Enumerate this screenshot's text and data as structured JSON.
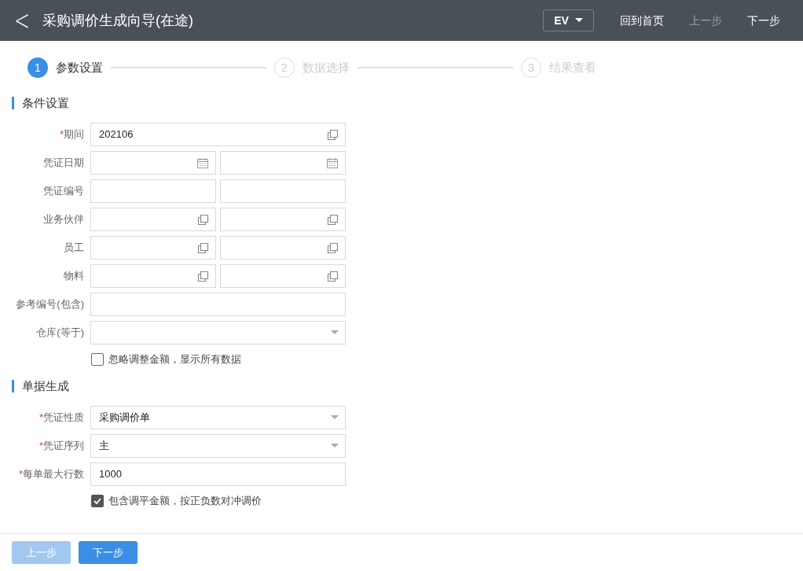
{
  "header": {
    "back": "<",
    "title": "采购调价生成向导(在途)",
    "language": "EV",
    "actions": [
      {
        "label": "回到首页",
        "disabled": false
      },
      {
        "label": "上一步",
        "disabled": true
      },
      {
        "label": "下一步",
        "disabled": false
      }
    ]
  },
  "steps": [
    {
      "number": "1",
      "label": "参数设置",
      "selected": true
    },
    {
      "number": "2",
      "label": "数据选择",
      "selected": false
    },
    {
      "number": "3",
      "label": "结果查看",
      "selected": false
    }
  ],
  "sections": [
    {
      "title": "条件设置",
      "rows": [
        {
          "asterisk": "*",
          "label": "期间",
          "fields": [
            {
              "value": "202106",
              "kind": "lookup"
            }
          ]
        },
        {
          "label": "凭证日期",
          "fields": [
            {
              "kind": "calendar"
            },
            {
              "kind": "calendar"
            }
          ]
        },
        {
          "label": "凭证编号",
          "fields": [
            {
              "kind": "text"
            },
            {
              "kind": "text"
            }
          ]
        },
        {
          "label": "业务伙伴",
          "fields": [
            {
              "kind": "lookup"
            },
            {
              "kind": "lookup"
            }
          ]
        },
        {
          "label": "员工",
          "fields": [
            {
              "kind": "lookup"
            },
            {
              "kind": "lookup"
            }
          ]
        },
        {
          "label": "物料",
          "fields": [
            {
              "kind": "lookup"
            },
            {
              "kind": "lookup"
            }
          ]
        },
        {
          "label": "参考编号(包含)",
          "fields": [
            {
              "kind": "text"
            }
          ]
        },
        {
          "label": "仓库(等于)",
          "fields": [
            {
              "kind": "dropdown"
            }
          ]
        }
      ],
      "checkbox": {
        "label": "忽略调整金额，显示所有数据",
        "checked": false
      }
    },
    {
      "title": "单据生成",
      "rows": [
        {
          "asterisk": "*",
          "label": "凭证性质",
          "fields": [
            {
              "value": "采购调价单",
              "kind": "dropdown"
            }
          ]
        },
        {
          "asterisk": "*",
          "label": "凭证序列",
          "fields": [
            {
              "value": "主",
              "kind": "dropdown"
            }
          ]
        },
        {
          "asterisk": "*",
          "label": "每单最大行数",
          "fields": [
            {
              "value": "1000",
              "kind": "text"
            }
          ]
        }
      ],
      "checkbox": {
        "label": "包含调平金额，按正负数对冲调价",
        "checked": true
      }
    }
  ],
  "footer": [
    {
      "label": "上一步",
      "disabled": true
    },
    {
      "label": "下一步",
      "disabled": false
    }
  ]
}
